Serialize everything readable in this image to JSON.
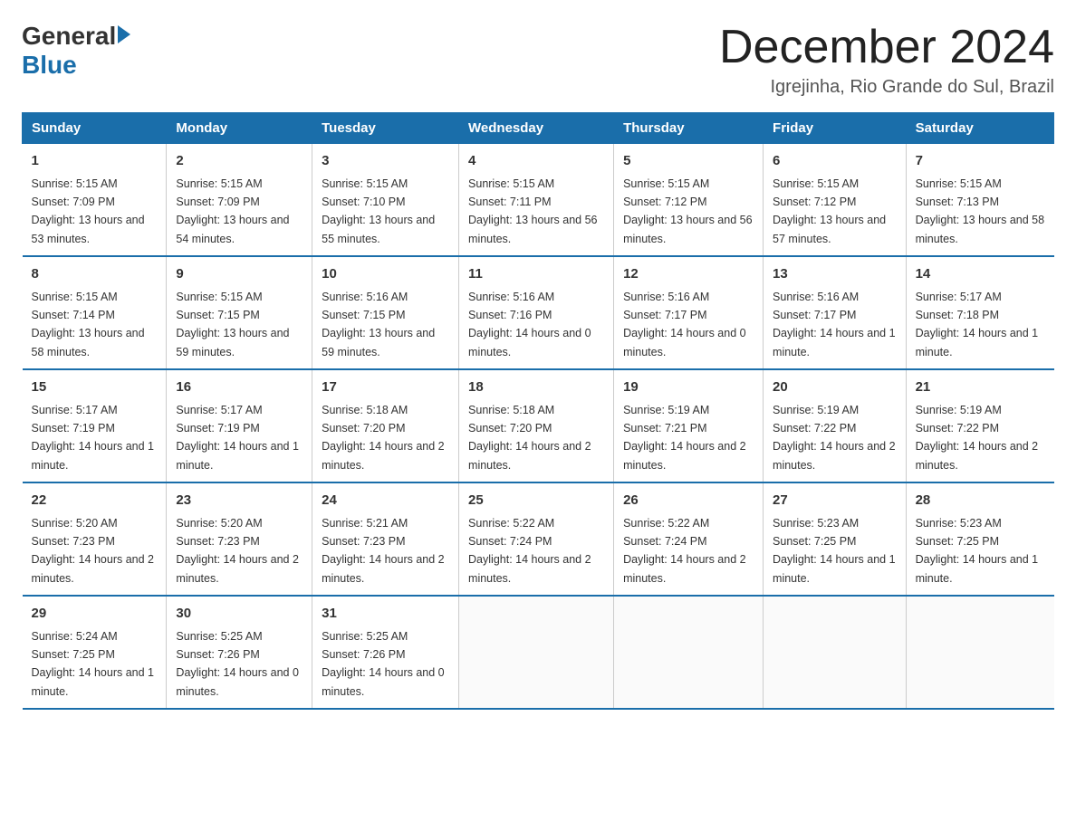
{
  "header": {
    "logo_general": "General",
    "logo_blue": "Blue",
    "month_title": "December 2024",
    "location": "Igrejinha, Rio Grande do Sul, Brazil"
  },
  "days_of_week": [
    "Sunday",
    "Monday",
    "Tuesday",
    "Wednesday",
    "Thursday",
    "Friday",
    "Saturday"
  ],
  "weeks": [
    [
      {
        "num": "1",
        "sunrise": "5:15 AM",
        "sunset": "7:09 PM",
        "daylight": "13 hours and 53 minutes."
      },
      {
        "num": "2",
        "sunrise": "5:15 AM",
        "sunset": "7:09 PM",
        "daylight": "13 hours and 54 minutes."
      },
      {
        "num": "3",
        "sunrise": "5:15 AM",
        "sunset": "7:10 PM",
        "daylight": "13 hours and 55 minutes."
      },
      {
        "num": "4",
        "sunrise": "5:15 AM",
        "sunset": "7:11 PM",
        "daylight": "13 hours and 56 minutes."
      },
      {
        "num": "5",
        "sunrise": "5:15 AM",
        "sunset": "7:12 PM",
        "daylight": "13 hours and 56 minutes."
      },
      {
        "num": "6",
        "sunrise": "5:15 AM",
        "sunset": "7:12 PM",
        "daylight": "13 hours and 57 minutes."
      },
      {
        "num": "7",
        "sunrise": "5:15 AM",
        "sunset": "7:13 PM",
        "daylight": "13 hours and 58 minutes."
      }
    ],
    [
      {
        "num": "8",
        "sunrise": "5:15 AM",
        "sunset": "7:14 PM",
        "daylight": "13 hours and 58 minutes."
      },
      {
        "num": "9",
        "sunrise": "5:15 AM",
        "sunset": "7:15 PM",
        "daylight": "13 hours and 59 minutes."
      },
      {
        "num": "10",
        "sunrise": "5:16 AM",
        "sunset": "7:15 PM",
        "daylight": "13 hours and 59 minutes."
      },
      {
        "num": "11",
        "sunrise": "5:16 AM",
        "sunset": "7:16 PM",
        "daylight": "14 hours and 0 minutes."
      },
      {
        "num": "12",
        "sunrise": "5:16 AM",
        "sunset": "7:17 PM",
        "daylight": "14 hours and 0 minutes."
      },
      {
        "num": "13",
        "sunrise": "5:16 AM",
        "sunset": "7:17 PM",
        "daylight": "14 hours and 1 minute."
      },
      {
        "num": "14",
        "sunrise": "5:17 AM",
        "sunset": "7:18 PM",
        "daylight": "14 hours and 1 minute."
      }
    ],
    [
      {
        "num": "15",
        "sunrise": "5:17 AM",
        "sunset": "7:19 PM",
        "daylight": "14 hours and 1 minute."
      },
      {
        "num": "16",
        "sunrise": "5:17 AM",
        "sunset": "7:19 PM",
        "daylight": "14 hours and 1 minute."
      },
      {
        "num": "17",
        "sunrise": "5:18 AM",
        "sunset": "7:20 PM",
        "daylight": "14 hours and 2 minutes."
      },
      {
        "num": "18",
        "sunrise": "5:18 AM",
        "sunset": "7:20 PM",
        "daylight": "14 hours and 2 minutes."
      },
      {
        "num": "19",
        "sunrise": "5:19 AM",
        "sunset": "7:21 PM",
        "daylight": "14 hours and 2 minutes."
      },
      {
        "num": "20",
        "sunrise": "5:19 AM",
        "sunset": "7:22 PM",
        "daylight": "14 hours and 2 minutes."
      },
      {
        "num": "21",
        "sunrise": "5:19 AM",
        "sunset": "7:22 PM",
        "daylight": "14 hours and 2 minutes."
      }
    ],
    [
      {
        "num": "22",
        "sunrise": "5:20 AM",
        "sunset": "7:23 PM",
        "daylight": "14 hours and 2 minutes."
      },
      {
        "num": "23",
        "sunrise": "5:20 AM",
        "sunset": "7:23 PM",
        "daylight": "14 hours and 2 minutes."
      },
      {
        "num": "24",
        "sunrise": "5:21 AM",
        "sunset": "7:23 PM",
        "daylight": "14 hours and 2 minutes."
      },
      {
        "num": "25",
        "sunrise": "5:22 AM",
        "sunset": "7:24 PM",
        "daylight": "14 hours and 2 minutes."
      },
      {
        "num": "26",
        "sunrise": "5:22 AM",
        "sunset": "7:24 PM",
        "daylight": "14 hours and 2 minutes."
      },
      {
        "num": "27",
        "sunrise": "5:23 AM",
        "sunset": "7:25 PM",
        "daylight": "14 hours and 1 minute."
      },
      {
        "num": "28",
        "sunrise": "5:23 AM",
        "sunset": "7:25 PM",
        "daylight": "14 hours and 1 minute."
      }
    ],
    [
      {
        "num": "29",
        "sunrise": "5:24 AM",
        "sunset": "7:25 PM",
        "daylight": "14 hours and 1 minute."
      },
      {
        "num": "30",
        "sunrise": "5:25 AM",
        "sunset": "7:26 PM",
        "daylight": "14 hours and 0 minutes."
      },
      {
        "num": "31",
        "sunrise": "5:25 AM",
        "sunset": "7:26 PM",
        "daylight": "14 hours and 0 minutes."
      },
      null,
      null,
      null,
      null
    ]
  ]
}
